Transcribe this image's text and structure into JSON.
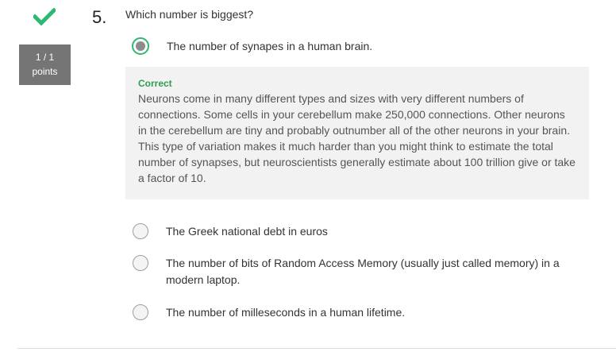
{
  "question": {
    "number": "5.",
    "text": "Which number is biggest?"
  },
  "score": {
    "value": "1 / 1",
    "unit": "points",
    "status_icon": "check-icon",
    "status_color": "#2eb872"
  },
  "options": [
    {
      "label": "The number of synapes in a human brain.",
      "selected": true
    },
    {
      "label": "The Greek national debt in euros",
      "selected": false
    },
    {
      "label": "The number of bits of Random Access Memory (usually just called memory) in a modern laptop.",
      "selected": false
    },
    {
      "label": "The number of milleseconds in a human lifetime.",
      "selected": false
    }
  ],
  "feedback": {
    "status": "Correct",
    "status_color": "#2e9e4f",
    "text": "Neurons come in many different types and sizes with very different numbers of connections. Some cells in your cerebellum make 250,000 connections. Other neurons in the cerebellum are tiny and probably outnumber all of the other neurons in your brain. This type of variation makes it much harder than you might think to estimate the total number of synapses, but neuroscientists generally estimate about 100 trillion give or take a factor of 10."
  }
}
